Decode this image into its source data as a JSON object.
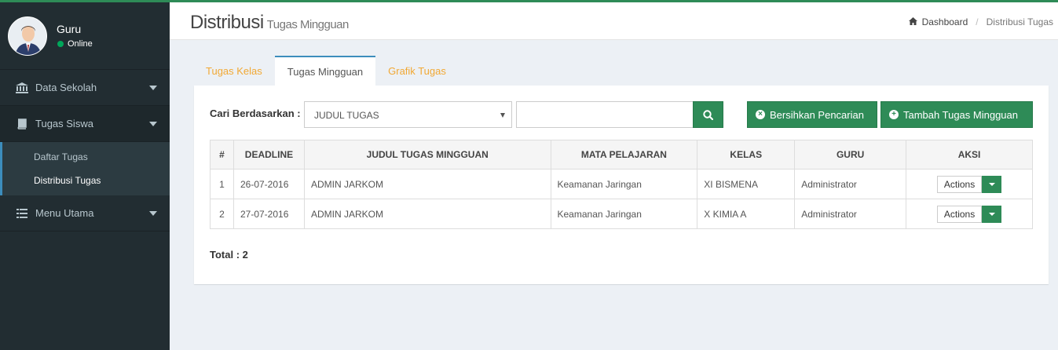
{
  "user": {
    "name": "Guru",
    "status": "Online"
  },
  "sidebar": {
    "items": [
      {
        "label": "Data Sekolah",
        "icon": "bank-icon"
      },
      {
        "label": "Tugas Siswa",
        "icon": "book-icon"
      },
      {
        "label": "Menu Utama",
        "icon": "list-icon"
      }
    ],
    "submenu": [
      {
        "label": "Daftar Tugas"
      },
      {
        "label": "Distribusi Tugas"
      }
    ]
  },
  "header": {
    "title": "Distribusi",
    "subtitle": "Tugas Mingguan",
    "breadcrumb": {
      "home": "Dashboard",
      "current": "Distribusi Tugas"
    }
  },
  "tabs": [
    {
      "label": "Tugas Kelas"
    },
    {
      "label": "Tugas Mingguan"
    },
    {
      "label": "Grafik Tugas"
    }
  ],
  "search": {
    "label": "Cari Berdasarkan :",
    "selected": "JUDUL TUGAS",
    "value": "",
    "clear_label": "Bersihkan Pencarian",
    "add_label": "Tambah Tugas Mingguan"
  },
  "table": {
    "headers": [
      "#",
      "DEADLINE",
      "JUDUL TUGAS MINGGUAN",
      "MATA PELAJARAN",
      "KELAS",
      "GURU",
      "AKSI"
    ],
    "rows": [
      {
        "no": "1",
        "deadline": "26-07-2016",
        "judul": "ADMIN JARKOM",
        "mapel": "Keamanan Jaringan",
        "kelas": "XI BISMENA",
        "guru": "Administrator",
        "action": "Actions"
      },
      {
        "no": "2",
        "deadline": "27-07-2016",
        "judul": "ADMIN JARKOM",
        "mapel": "Keamanan Jaringan",
        "kelas": "X KIMIA A",
        "guru": "Administrator",
        "action": "Actions"
      }
    ]
  },
  "total": "Total : 2",
  "colors": {
    "accent": "#2e8b57",
    "sidebar": "#222d32",
    "tab_link": "#f39c12"
  }
}
